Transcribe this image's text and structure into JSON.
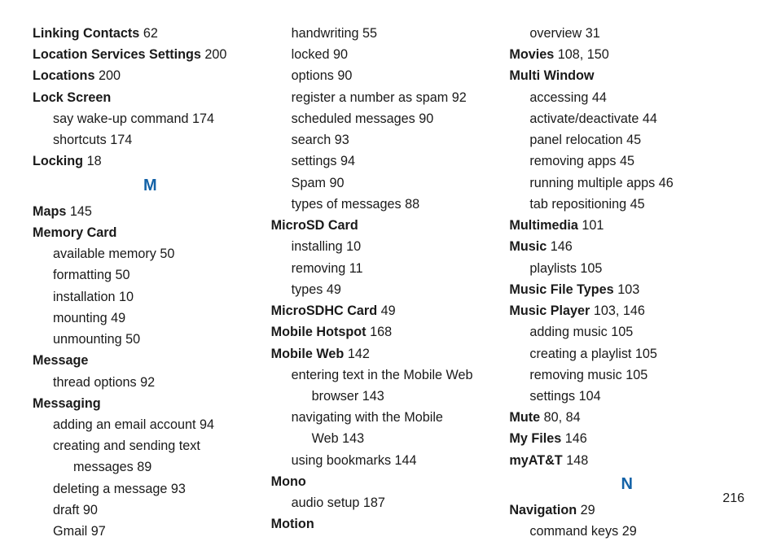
{
  "page_number": "216",
  "letters": {
    "M": "M",
    "N": "N"
  },
  "col1": {
    "l0": {
      "t": "Linking Contacts",
      "p": "62"
    },
    "l1": {
      "t": "Location Services Settings",
      "p": "200"
    },
    "l2": {
      "t": "Locations",
      "p": "200"
    },
    "l3": {
      "t": "Lock Screen"
    },
    "l3a": {
      "t": "say wake-up command",
      "p": "174"
    },
    "l3b": {
      "t": "shortcuts",
      "p": "174"
    },
    "l4": {
      "t": "Locking",
      "p": "18"
    },
    "m1": {
      "t": "Maps",
      "p": "145"
    },
    "m2": {
      "t": "Memory Card"
    },
    "m2a": {
      "t": "available memory",
      "p": "50"
    },
    "m2b": {
      "t": "formatting",
      "p": "50"
    },
    "m2c": {
      "t": "installation",
      "p": "10"
    },
    "m2d": {
      "t": "mounting",
      "p": "49"
    },
    "m2e": {
      "t": "unmounting",
      "p": "50"
    },
    "m3": {
      "t": "Message"
    },
    "m3a": {
      "t": "thread options",
      "p": "92"
    },
    "m4": {
      "t": "Messaging"
    },
    "m4a": {
      "t": "adding an email account",
      "p": "94"
    },
    "m4b_l1": "creating and sending text",
    "m4b_l2": "messages",
    "m4b_p": "89",
    "m4c": {
      "t": "deleting a message",
      "p": "93"
    },
    "m4d": {
      "t": "draft",
      "p": "90"
    },
    "m4e": {
      "t": "Gmail",
      "p": "97"
    }
  },
  "col2": {
    "m5a": {
      "t": "handwriting",
      "p": "55"
    },
    "m5b": {
      "t": "locked",
      "p": "90"
    },
    "m5c": {
      "t": "options",
      "p": "90"
    },
    "m5d": {
      "t": "register a number as spam",
      "p": "92"
    },
    "m5e": {
      "t": "scheduled messages",
      "p": "90"
    },
    "m5f": {
      "t": "search",
      "p": "93"
    },
    "m5g": {
      "t": "settings",
      "p": "94"
    },
    "m5h": {
      "t": "Spam",
      "p": "90"
    },
    "m5i": {
      "t": "types of messages",
      "p": "88"
    },
    "m6": {
      "t": "MicroSD Card"
    },
    "m6a": {
      "t": "installing",
      "p": "10"
    },
    "m6b": {
      "t": "removing",
      "p": "11"
    },
    "m6c": {
      "t": "types",
      "p": "49"
    },
    "m7": {
      "t": "MicroSDHC Card",
      "p": "49"
    },
    "m8": {
      "t": "Mobile Hotspot",
      "p": "168"
    },
    "m9": {
      "t": "Mobile Web",
      "p": "142"
    },
    "m9a_l1": "entering text in the Mobile Web",
    "m9a_l2": "browser",
    "m9a_p": "143",
    "m9b_l1": "navigating with the Mobile",
    "m9b_l2": "Web",
    "m9b_p": "143",
    "m9c": {
      "t": "using bookmarks",
      "p": "144"
    },
    "m10": {
      "t": "Mono"
    },
    "m10a": {
      "t": "audio setup",
      "p": "187"
    },
    "m11": {
      "t": "Motion"
    }
  },
  "col3": {
    "m11a": {
      "t": "overview",
      "p": "31"
    },
    "m12": {
      "t": "Movies",
      "p1": "108",
      "p2": "150"
    },
    "m13": {
      "t": "Multi Window"
    },
    "m13a": {
      "t": "accessing",
      "p": "44"
    },
    "m13b": {
      "t": "activate/deactivate",
      "p": "44"
    },
    "m13c": {
      "t": "panel relocation",
      "p": "45"
    },
    "m13d": {
      "t": "removing apps",
      "p": "45"
    },
    "m13e": {
      "t": "running multiple apps",
      "p": "46"
    },
    "m13f": {
      "t": "tab repositioning",
      "p": "45"
    },
    "m14": {
      "t": "Multimedia",
      "p": "101"
    },
    "m15": {
      "t": "Music",
      "p": "146"
    },
    "m15a": {
      "t": "playlists",
      "p": "105"
    },
    "m16": {
      "t": "Music File Types",
      "p": "103"
    },
    "m17": {
      "t": "Music Player",
      "p1": "103",
      "p2": "146"
    },
    "m17a": {
      "t": "adding music",
      "p": "105"
    },
    "m17b": {
      "t": "creating a playlist",
      "p": "105"
    },
    "m17c": {
      "t": "removing music",
      "p": "105"
    },
    "m17d": {
      "t": "settings",
      "p": "104"
    },
    "m18": {
      "t": "Mute",
      "p1": "80",
      "p2": "84"
    },
    "m19": {
      "t": "My Files",
      "p": "146"
    },
    "m20": {
      "t": "myAT&T",
      "p": "148"
    },
    "n1": {
      "t": "Navigation",
      "p": "29"
    },
    "n1a": {
      "t": "command keys",
      "p": "29"
    }
  }
}
